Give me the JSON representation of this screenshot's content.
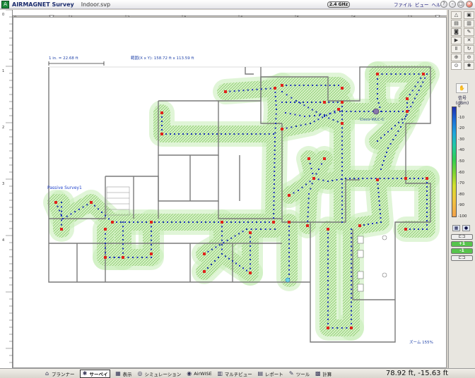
{
  "window": {
    "app_title": "AIRMAGNET Survey",
    "doc_title": "Indoor.svp",
    "freq": "2.4 GHz",
    "menu": [
      "ファイル",
      "ビュー",
      "ヘルプ"
    ]
  },
  "canvas": {
    "scale": "1 in. = 22.68 ft",
    "extent": "範囲(X x Y): 158.72 ft x 113.59 ft",
    "zoom": "ズーム 155%",
    "label_survey": "Passive Survey1",
    "label_ap": "Cisco-WLC-C"
  },
  "ruler": {
    "top": [
      "0",
      "1",
      "2",
      "3",
      "4",
      "5",
      "6",
      "7"
    ],
    "left": [
      "0",
      "1",
      "2",
      "3",
      "4"
    ]
  },
  "legend": {
    "title": "信号",
    "unit": "(dBm)",
    "ticks": [
      "0",
      "-10",
      "-20",
      "-30",
      "-40",
      "-50",
      "-60",
      "-70",
      "-80",
      "-90",
      "-100"
    ],
    "colors": {
      "strong": "#1f2fb0",
      "mid": "#2fcf52",
      "weak": "#f4a24a"
    }
  },
  "side_buttons": [
    "⊏⊐",
    "+1",
    "-1",
    "⊏⊐"
  ],
  "statusbar": {
    "items": [
      {
        "icon": "planner-icon",
        "label": "プランナー",
        "active": false
      },
      {
        "icon": "survey-icon",
        "label": "サーベイ",
        "active": true
      },
      {
        "icon": "display-icon",
        "label": "表示",
        "active": false
      },
      {
        "icon": "simulation-icon",
        "label": "シミュレーション",
        "active": false
      },
      {
        "icon": "airwise-icon",
        "label": "AirWISE",
        "active": false
      },
      {
        "icon": "multiview-icon",
        "label": "マルチビュー",
        "active": false
      },
      {
        "icon": "report-icon",
        "label": "レポート",
        "active": false
      },
      {
        "icon": "tool-icon",
        "label": "ツール",
        "active": false
      },
      {
        "icon": "calc-icon",
        "label": "計算",
        "active": false
      }
    ],
    "coords": "78.92 ft, -15.63 ft"
  }
}
